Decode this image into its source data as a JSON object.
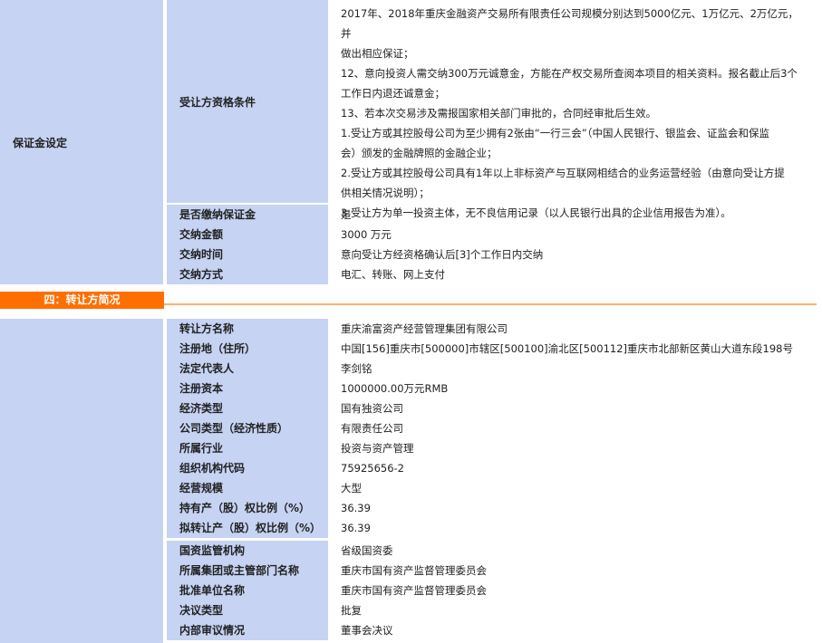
{
  "top": {
    "section_label": "保证金设定",
    "requirements_label": "受让方资格条件",
    "requirements_lines": [
      "2017年、2018年重庆金融资产交易所有限责任公司规模分别达到5000亿元、1万亿元、2万亿元，并",
      "做出相应保证；",
      "12、意向投资人需交纳300万元诚意金，方能在产权交易所查阅本项目的相关资料。报名截止后3个",
      "工作日内退还诚意金；",
      "13、若本次交易涉及需报国家相关部门审批的，合同经审批后生效。",
      "1.受让方或其控股母公司为至少拥有2张由“一行三会”（中国人民银行、银监会、证监会和保监",
      "会）颁发的金融牌照的金融企业；",
      "2.受让方或其控股母公司具有1年以上非标资产与互联网相结合的业务运营经验（由意向受让方提",
      "供相关情况说明）；",
      "3.受让方为单一投资主体，无不良信用记录（以人民银行出具的企业信用报告为准）。"
    ],
    "deposit_rows": [
      {
        "label": "是否缴纳保证金",
        "value": "是"
      },
      {
        "label": "交纳金额",
        "value": "3000 万元"
      },
      {
        "label": "交纳时间",
        "value": "意向受让方经资格确认后[3]个工作日内交纳"
      },
      {
        "label": "交纳方式",
        "value": "电汇、转账、网上支付"
      }
    ]
  },
  "section_header": "四：转让方简况",
  "transferor_rows_a": [
    {
      "label": "转让方名称",
      "value": "重庆渝富资产经营管理集团有限公司"
    },
    {
      "label": "注册地（住所）",
      "value": "中国[156]重庆市[500000]市辖区[500100]渝北区[500112]重庆市北部新区黄山大道东段198号"
    },
    {
      "label": "法定代表人",
      "value": "李剑铭"
    },
    {
      "label": "注册资本",
      "value": "1000000.00万元RMB"
    },
    {
      "label": "经济类型",
      "value": "国有独资公司"
    },
    {
      "label": "公司类型（经济性质）",
      "value": "有限责任公司"
    },
    {
      "label": "所属行业",
      "value": "投资与资产管理"
    },
    {
      "label": "组织机构代码",
      "value": "75925656-2"
    },
    {
      "label": "经营规模",
      "value": "大型"
    },
    {
      "label": "持有产（股）权比例（%）",
      "value": "36.39"
    },
    {
      "label": "拟转让产（股）权比例（%）",
      "value": "36.39"
    }
  ],
  "transferor_rows_b": [
    {
      "label": "国资监管机构",
      "value": "省级国资委"
    },
    {
      "label": "所属集团或主管部门名称",
      "value": "重庆市国有资产监督管理委员会"
    },
    {
      "label": "批准单位名称",
      "value": "重庆市国有资产监督管理委员会"
    },
    {
      "label": "决议类型",
      "value": "批复"
    },
    {
      "label": "内部审议情况",
      "value": "董事会决议"
    }
  ]
}
